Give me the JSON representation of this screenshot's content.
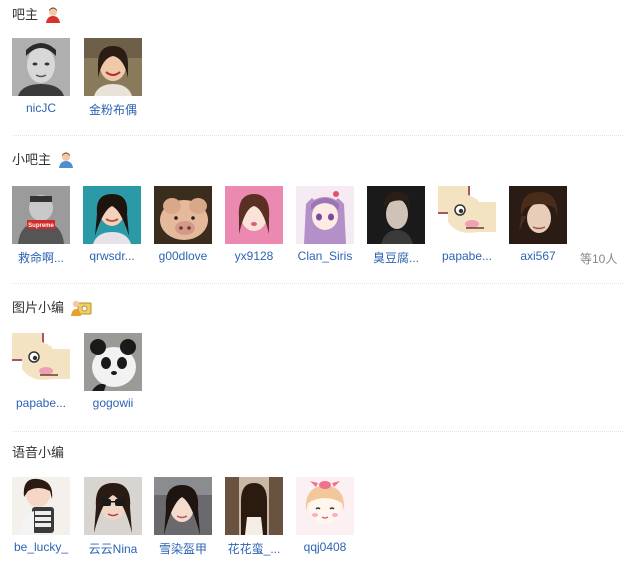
{
  "sections": [
    {
      "title": "吧主",
      "icon": "bazhu-person-icon",
      "members": [
        {
          "name": "nicJC",
          "avatar": "man-bw-portrait"
        },
        {
          "name": "金粉布偶",
          "avatar": "girl-smiling"
        }
      ]
    },
    {
      "title": "小吧主",
      "icon": "xiaobazhu-person-icon",
      "members": [
        {
          "name": "救命啊...",
          "avatar": "old-man-supreme"
        },
        {
          "name": "qrwsdr...",
          "avatar": "woman-teal"
        },
        {
          "name": "g00dlove",
          "avatar": "pig"
        },
        {
          "name": "yx9128",
          "avatar": "girl-pink"
        },
        {
          "name": "Clan_Siris",
          "avatar": "anime-girl-purple"
        },
        {
          "name": "臭豆腐...",
          "avatar": "man-dark"
        },
        {
          "name": "papabe...",
          "avatar": "cartoon-face"
        },
        {
          "name": "axi567",
          "avatar": "boy-portrait"
        }
      ],
      "more": "等10人"
    },
    {
      "title": "图片小编",
      "icon": "photo-editor-icon",
      "members": [
        {
          "name": "papabe...",
          "avatar": "cartoon-face"
        },
        {
          "name": "gogowii",
          "avatar": "panda"
        }
      ]
    },
    {
      "title": "语音小编",
      "icon": "",
      "members": [
        {
          "name": "be_lucky_",
          "avatar": "cartoon-girl-phone"
        },
        {
          "name": "云云Nina",
          "avatar": "girl-sunglasses"
        },
        {
          "name": "雪染盔甲",
          "avatar": "girl-car"
        },
        {
          "name": "花花蛮_...",
          "avatar": "girl-back"
        },
        {
          "name": "qqj0408",
          "avatar": "cartoon-girl-bow"
        }
      ]
    }
  ],
  "colors": {
    "link": "#2d64b3",
    "text": "#333333",
    "muted": "#888888",
    "divider": "#e2e2e2"
  }
}
